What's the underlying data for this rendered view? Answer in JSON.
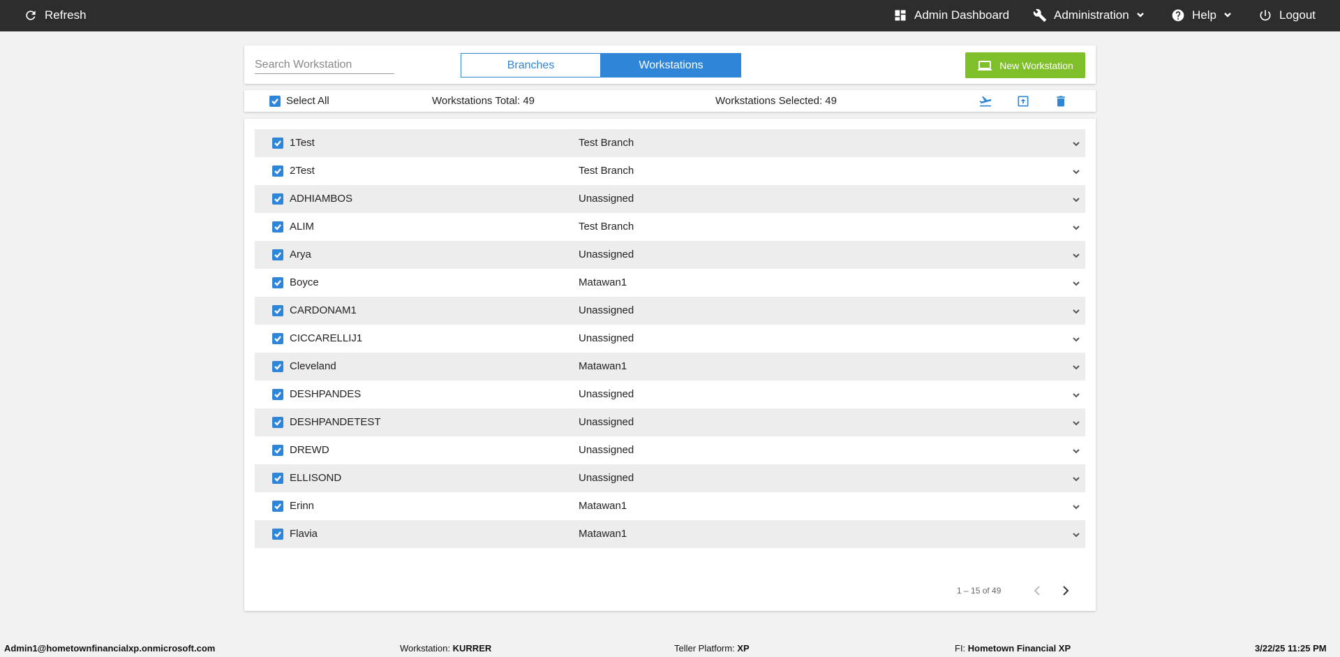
{
  "topbar": {
    "refresh_label": "Refresh",
    "admin_dashboard_label": "Admin Dashboard",
    "administration_label": "Administration",
    "help_label": "Help",
    "logout_label": "Logout",
    "background": "#2d2d2d"
  },
  "search": {
    "placeholder": "Search Workstation",
    "value": ""
  },
  "tabs": [
    {
      "label": "Branches",
      "active": false
    },
    {
      "label": "Workstations",
      "active": true
    }
  ],
  "new_workstation_label": "New Workstation",
  "summary": {
    "select_all_label": "Select All",
    "total_text": "Workstations Total: 49",
    "selected_text": "Workstations Selected: 49"
  },
  "workstations": [
    {
      "name": "1Test",
      "branch": "Test Branch"
    },
    {
      "name": "2Test",
      "branch": "Test Branch"
    },
    {
      "name": "ADHIAMBOS",
      "branch": "Unassigned"
    },
    {
      "name": "ALIM",
      "branch": "Test Branch"
    },
    {
      "name": "Arya",
      "branch": "Unassigned"
    },
    {
      "name": "Boyce",
      "branch": "Matawan1"
    },
    {
      "name": "CARDONAM1",
      "branch": "Unassigned"
    },
    {
      "name": "CICCARELLIJ1",
      "branch": "Unassigned"
    },
    {
      "name": "Cleveland",
      "branch": "Matawan1"
    },
    {
      "name": "DESHPANDES",
      "branch": "Unassigned"
    },
    {
      "name": "DESHPANDETEST",
      "branch": "Unassigned"
    },
    {
      "name": "DREWD",
      "branch": "Unassigned"
    },
    {
      "name": "ELLISOND",
      "branch": "Unassigned"
    },
    {
      "name": "Erinn",
      "branch": "Matawan1"
    },
    {
      "name": "Flavia",
      "branch": "Matawan1"
    }
  ],
  "pagination": {
    "label": "1 – 15 of 49"
  },
  "footer": {
    "user": "Admin1@hometownfinancialxp.onmicrosoft.com",
    "workstation_label": "Workstation:",
    "workstation_value": "KURRER",
    "platform_label": "Teller Platform:",
    "platform_value": "XP",
    "fi_label": "FI:",
    "fi_value": "Hometown Financial XP",
    "datetime": "3/22/25 11:25 PM"
  },
  "colors": {
    "accent": "#2f86d8",
    "new_button": "#7fbf2a",
    "row_alt": "#ededed"
  }
}
